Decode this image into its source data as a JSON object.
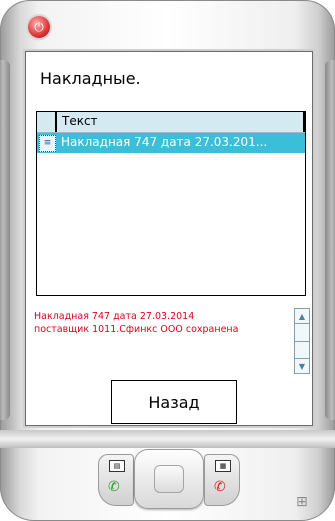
{
  "screen": {
    "title": "Накладные."
  },
  "list": {
    "header_label": "Текст",
    "rows": [
      {
        "text": "Накладная 747 дата 27.03.201...",
        "icon": "document-icon",
        "selected": true
      }
    ]
  },
  "message": {
    "line1": "Накладная 747 дата 27.03.2014",
    "line2": "поставщик 1011.Сфинкс ООО сохранена"
  },
  "buttons": {
    "back_label": "Назад"
  },
  "device": {
    "power_icon": "power-icon",
    "left_softkey_icon": "softkey-left-icon",
    "right_softkey_icon": "softkey-right-icon",
    "call_icon": "call-green-icon",
    "end_call_icon": "call-end-red-icon",
    "windows_icon": "windows-icon"
  },
  "colors": {
    "header_bg": "#d4e9f2",
    "selected_row_bg": "#3bbfd8",
    "message_text": "#e0001b",
    "power_button": "#e04040"
  }
}
